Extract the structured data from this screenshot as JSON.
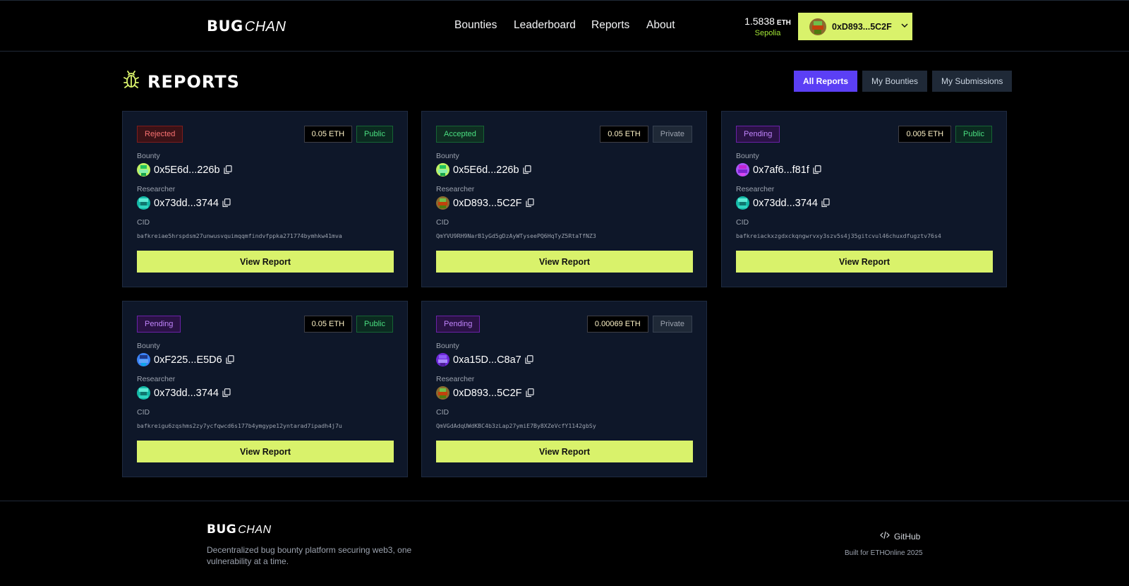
{
  "brand": {
    "bug": "BUG",
    "chan": "CHAN"
  },
  "nav": {
    "items": [
      "Bounties",
      "Leaderboard",
      "Reports",
      "About"
    ]
  },
  "wallet": {
    "balance": "1.5838",
    "unit": "ETH",
    "network": "Sepolia",
    "address": "0xD893...5C2F"
  },
  "page": {
    "title": "REPORTS"
  },
  "filters": {
    "items": [
      "All Reports",
      "My Bounties",
      "My Submissions"
    ],
    "active": "All Reports"
  },
  "labels": {
    "bounty": "Bounty",
    "researcher": "Researcher",
    "cid": "CID",
    "view_report": "View Report"
  },
  "reports": [
    {
      "status": "Rejected",
      "amount": "0.05 ETH",
      "visibility": "Public",
      "bounty": "0x5E6d...226b",
      "researcher": "0x73dd...3744",
      "cid": "bafkreiae5hrspdsm27unwusvquimqqmfindvfppka271774bymhkw41mva"
    },
    {
      "status": "Accepted",
      "amount": "0.05 ETH",
      "visibility": "Private",
      "bounty": "0x5E6d...226b",
      "researcher": "0xD893...5C2F",
      "cid": "QmYVU9RH9NarB1yGd5gDzAyWTyseePQ6HqTyZ5RtaTfNZ3"
    },
    {
      "status": "Pending",
      "amount": "0.005 ETH",
      "visibility": "Public",
      "bounty": "0x7af6...f81f",
      "researcher": "0x73dd...3744",
      "cid": "bafkreiackxzgdxckqngwrvxy3szv5s4j35gitcvul46chuxdfugztv76s4"
    },
    {
      "status": "Pending",
      "amount": "0.05 ETH",
      "visibility": "Public",
      "bounty": "0xF225...E5D6",
      "researcher": "0x73dd...3744",
      "cid": "bafkreigu6zqshms2zy7ycfqwcd6s177b4ymgype12yntarad7ipadh4j7u"
    },
    {
      "status": "Pending",
      "amount": "0.00069 ETH",
      "visibility": "Private",
      "bounty": "0xa15D...C8a7",
      "researcher": "0xD893...5C2F",
      "cid": "QmVGdAdqUWdKBC4b3zLap27ymiE7By8XZeVcfY1142gbSy"
    }
  ],
  "footer": {
    "tagline": "Decentralized bug bounty platform securing web3, one vulnerability at a time.",
    "github": "GitHub",
    "built": "Built for ETHOnline 2025"
  },
  "colors": {
    "accent": "#d9f26b",
    "primary": "#5b3ff5",
    "background": "#000000",
    "card": "#0e1729"
  },
  "icons": {
    "logo": "bug-icon",
    "copy": "copy-icon",
    "chevron": "chevron-down-icon",
    "code": "code-icon"
  }
}
